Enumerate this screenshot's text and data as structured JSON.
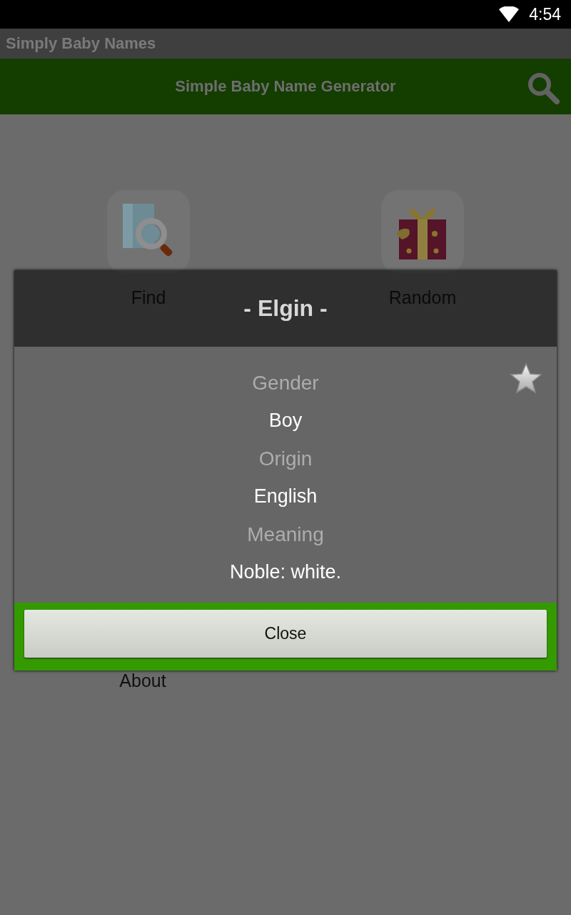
{
  "status_bar": {
    "time": "4:54"
  },
  "app_bar": {
    "title": "Simply Baby Names"
  },
  "action_bar": {
    "title": "Simple Baby Name Generator"
  },
  "home_items": [
    {
      "kind": "find",
      "label": "Find"
    },
    {
      "kind": "random",
      "label": "Random"
    }
  ],
  "about_item": {
    "label": "About"
  },
  "dialog": {
    "title": "- Elgin -",
    "fields": [
      {
        "label": "Gender",
        "value": "Boy"
      },
      {
        "label": "Origin",
        "value": "English"
      },
      {
        "label": "Meaning",
        "value": "Noble: white."
      }
    ],
    "button": "Close"
  }
}
